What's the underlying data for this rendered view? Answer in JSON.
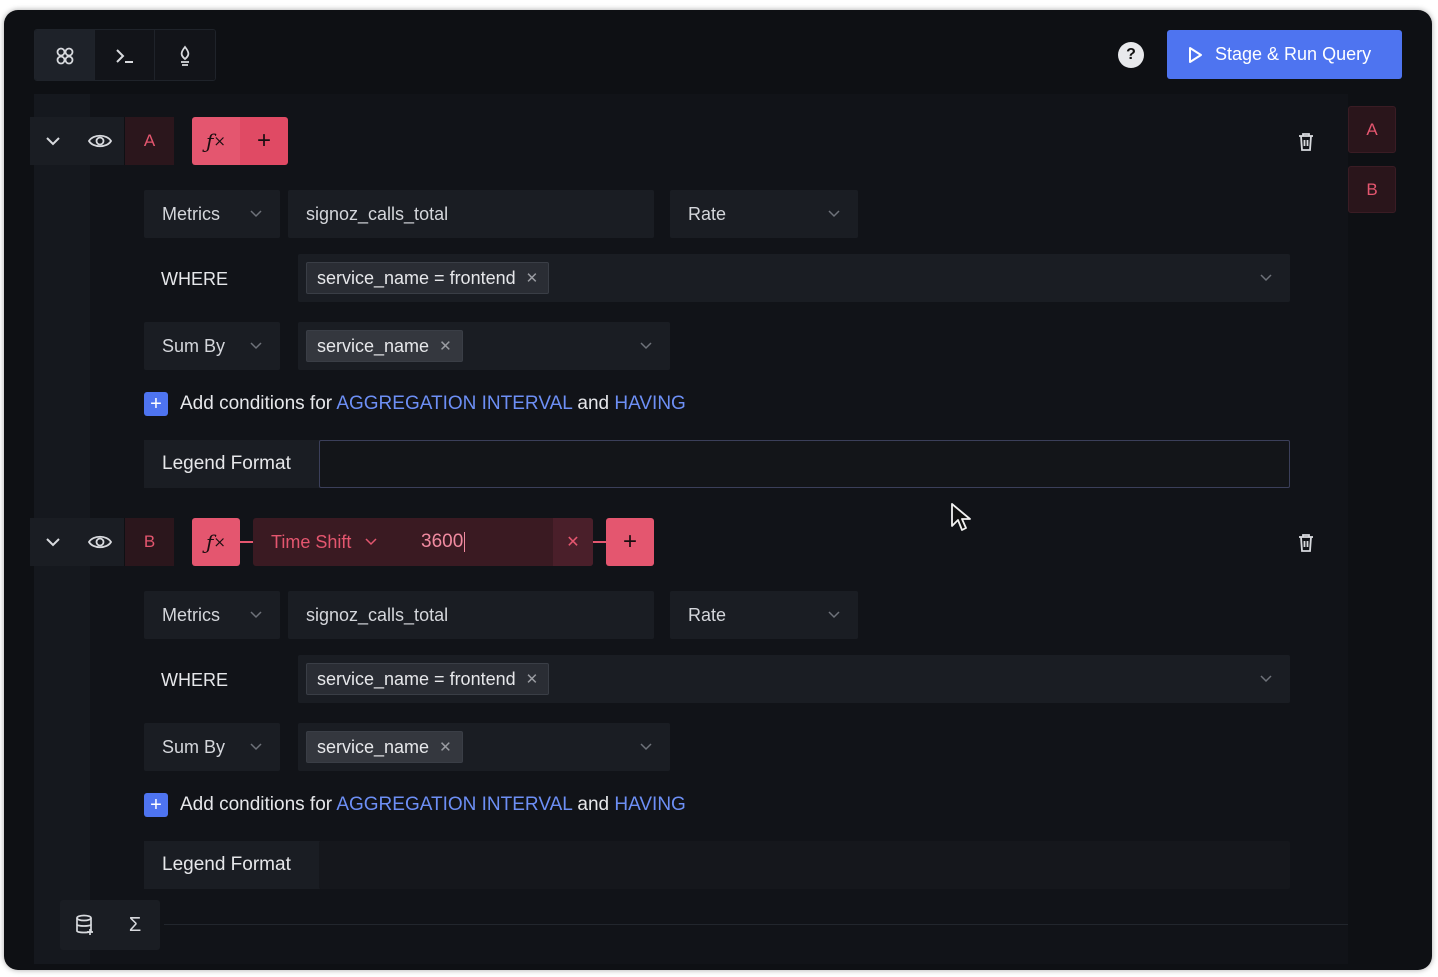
{
  "toolbar": {
    "tools": [
      {
        "name": "query-builder-icon"
      },
      {
        "name": "terminal-icon"
      },
      {
        "name": "promql-icon"
      }
    ],
    "run_label": "Stage & Run Query",
    "help_label": "?"
  },
  "side_tabs": [
    "A",
    "B"
  ],
  "queries": [
    {
      "letter": "A",
      "aggregate": {
        "label": "Metrics",
        "value": "signoz_calls_total",
        "op": "Rate"
      },
      "where": {
        "label": "WHERE",
        "tag": "service_name = frontend"
      },
      "group_by": {
        "label": "Sum By",
        "tag": "service_name"
      },
      "add_conditions": {
        "prefix": "Add conditions for",
        "interval": "AGGREGATION INTERVAL",
        "and": "and",
        "having": "HAVING"
      },
      "legend": {
        "label": "Legend Format",
        "value": ""
      }
    },
    {
      "letter": "B",
      "function": {
        "name": "Time Shift",
        "value": "3600"
      },
      "aggregate": {
        "label": "Metrics",
        "value": "signoz_calls_total",
        "op": "Rate"
      },
      "where": {
        "label": "WHERE",
        "tag": "service_name = frontend"
      },
      "group_by": {
        "label": "Sum By",
        "tag": "service_name"
      },
      "add_conditions": {
        "prefix": "Add conditions for",
        "interval": "AGGREGATION INTERVAL",
        "and": "and",
        "having": "HAVING"
      },
      "legend": {
        "label": "Legend Format",
        "value": ""
      }
    }
  ],
  "colors": {
    "accent": "#4e74f0",
    "query": "#e4566f",
    "background": "#0e1014"
  }
}
